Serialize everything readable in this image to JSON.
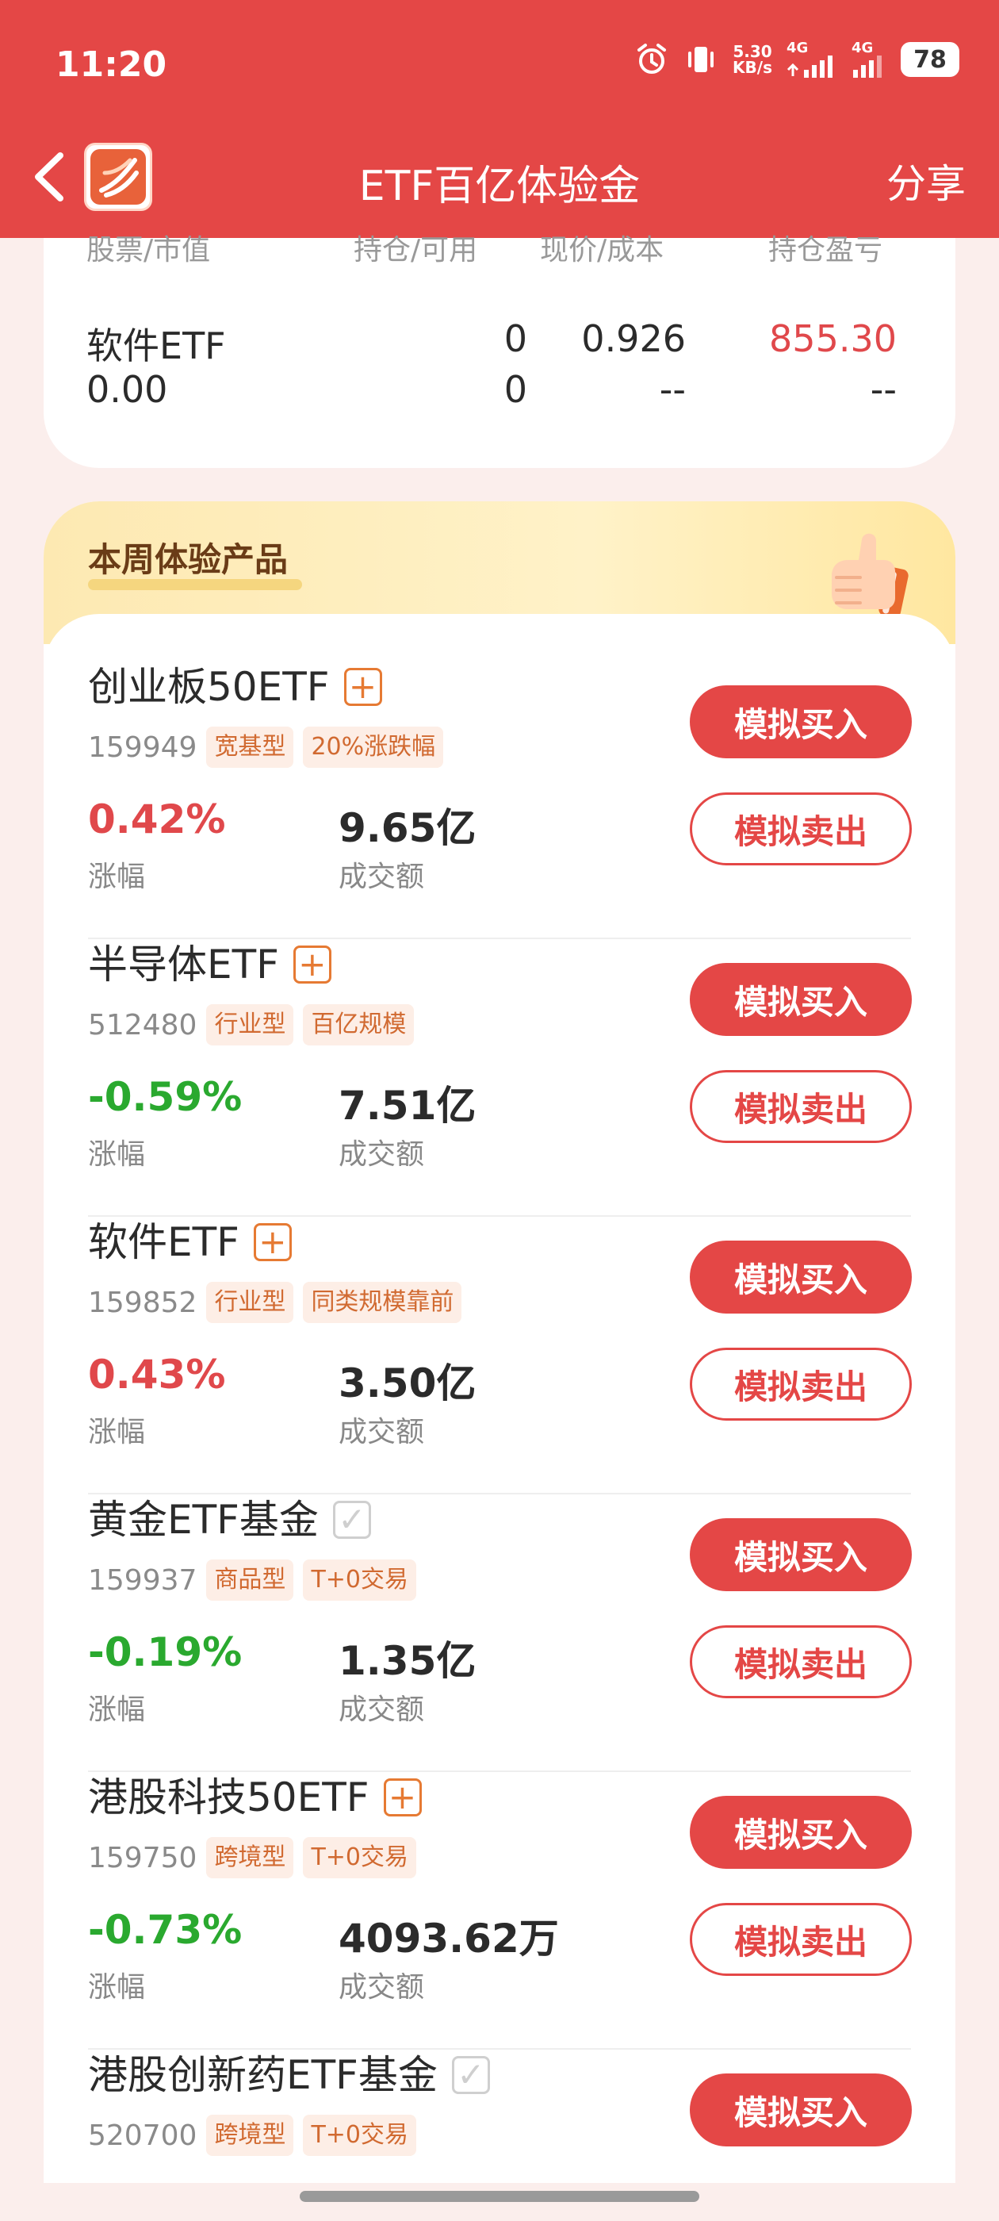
{
  "status_bar": {
    "time": "11:20",
    "speed_value": "5.30",
    "speed_unit": "KB/s",
    "network_1": "4G",
    "network_2": "4G",
    "battery": "78",
    "icons": [
      "alarm-icon",
      "vibrate-icon",
      "signal-icon",
      "battery-icon"
    ]
  },
  "header": {
    "title": "ETF百亿体验金",
    "share_label": "分享",
    "back_icon": "chevron-left-icon",
    "logo_icon": "app-logo-icon"
  },
  "holdings": {
    "columns": [
      "股票/市值",
      "持仓/可用",
      "现价/成本",
      "持仓盈亏"
    ],
    "row": {
      "name": "软件ETF",
      "market_value": "0.00",
      "position": "0",
      "available": "0",
      "price": "0.926",
      "cost": "--",
      "pnl": "855.30",
      "pnl_pct": "--"
    }
  },
  "section": {
    "title": "本周体验产品",
    "illustration": "thumbs-up-icon"
  },
  "buttons": {
    "buy": "模拟买入",
    "sell": "模拟卖出"
  },
  "labels": {
    "change": "涨幅",
    "turnover": "成交额"
  },
  "products": [
    {
      "name": "创业板50ETF",
      "code": "159949",
      "tags": [
        "宽基型",
        "20%涨跌幅"
      ],
      "change": "0.42%",
      "turnover": "9.65亿",
      "direction": "up",
      "added": false
    },
    {
      "name": "半导体ETF",
      "code": "512480",
      "tags": [
        "行业型",
        "百亿规模"
      ],
      "change": "-0.59%",
      "turnover": "7.51亿",
      "direction": "down",
      "added": false
    },
    {
      "name": "软件ETF",
      "code": "159852",
      "tags": [
        "行业型",
        "同类规模靠前"
      ],
      "change": "0.43%",
      "turnover": "3.50亿",
      "direction": "up",
      "added": false
    },
    {
      "name": "黄金ETF基金",
      "code": "159937",
      "tags": [
        "商品型",
        "T+0交易"
      ],
      "change": "-0.19%",
      "turnover": "1.35亿",
      "direction": "down",
      "added": true
    },
    {
      "name": "港股科技50ETF",
      "code": "159750",
      "tags": [
        "跨境型",
        "T+0交易"
      ],
      "change": "-0.73%",
      "turnover": "4093.62万",
      "direction": "down",
      "added": false
    },
    {
      "name": "港股创新药ETF基金",
      "code": "520700",
      "tags": [
        "跨境型",
        "T+0交易"
      ],
      "change": "",
      "turnover": "",
      "direction": "",
      "added": true
    }
  ],
  "colors": {
    "header": "#e44746",
    "up": "#e0484b",
    "down": "#2aa92f",
    "tag": "#d16a31"
  }
}
